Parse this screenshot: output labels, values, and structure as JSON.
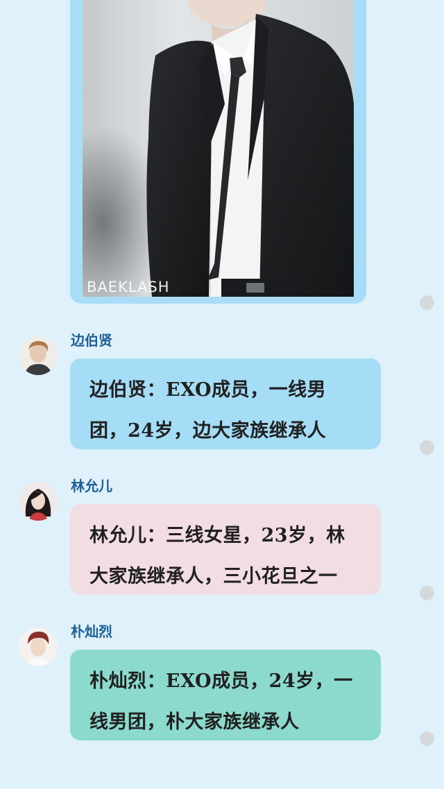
{
  "photo": {
    "watermark": "BAEKLASH"
  },
  "messages": [
    {
      "sender": "边伯贤",
      "text": "边伯贤：EXO成员，一线男\n团，24岁，边大家族继承人",
      "bubble_color": "#a5dcf6",
      "avatar_icon": "person-avatar-icon"
    },
    {
      "sender": "林允儿",
      "text": "林允儿：三线女星，23岁，林\n大家族继承人，三小花旦之一",
      "bubble_color": "#f1dde2",
      "avatar_icon": "person-avatar-icon"
    },
    {
      "sender": "朴灿烈",
      "text": "朴灿烈：EXO成员，24岁，一\n线男团，朴大家族继承人",
      "bubble_color": "#8cd9cd",
      "avatar_icon": "person-avatar-icon"
    }
  ],
  "colors": {
    "background": "#dff2fb",
    "sender_name": "#1e5f97",
    "status_dot": "#d6d9db"
  }
}
